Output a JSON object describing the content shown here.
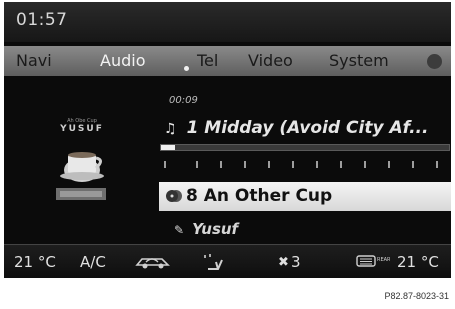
{
  "status": {
    "time": "01:57"
  },
  "menu": {
    "items": [
      {
        "label": "Navi"
      },
      {
        "label": "Audio"
      },
      {
        "label": "Tel"
      },
      {
        "label": "Video"
      },
      {
        "label": "System"
      }
    ],
    "active": "Audio"
  },
  "cover": {
    "small_text": "Ah Obe Cup",
    "title": "YUSUF"
  },
  "player": {
    "elapsed": "00:09",
    "track": "1 Midday (Avoid City Af...",
    "progress_fraction": 0.05,
    "album": "8 An Other Cup",
    "artist": "Yusuf"
  },
  "climate": {
    "left_temp": "21 °C",
    "ac_label": "A/C",
    "fan_level": "3",
    "right_temp": "21 °C"
  },
  "footer": {
    "figure_code": "P82.87-8023-31"
  },
  "colors": {
    "screen_bg": "#0b0b0b",
    "menu_bg": "#707070",
    "highlight": "#e6e6e6"
  },
  "icons": {
    "track": "music-note-icon",
    "album": "cd-stack-icon",
    "artist": "pen-icon",
    "recirculation": "car-recirculation-icon",
    "airflow": "seat-airflow-icon",
    "fan": "fan-icon",
    "rear_defrost": "rear-defrost-icon"
  }
}
